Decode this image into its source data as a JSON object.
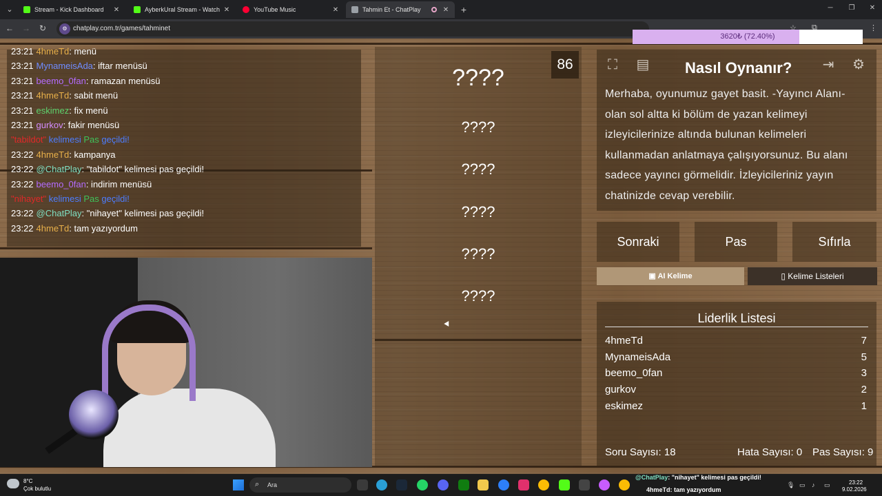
{
  "browser": {
    "tabs": [
      {
        "title": "Stream - Kick Dashboard",
        "icon": "kick-icon",
        "color": "#53fc18"
      },
      {
        "title": "AyberkUral Stream - Watch Live",
        "icon": "kick-icon",
        "color": "#53fc18"
      },
      {
        "title": "YouTube Music",
        "icon": "youtube-music-icon",
        "color": "#ff0033"
      },
      {
        "title": "Tahmin Et - ChatPlay",
        "icon": "chatplay-icon",
        "color": "#9aa0a6"
      }
    ],
    "url": "chatplay.com.tr/games/tahminet"
  },
  "chat": {
    "messages": [
      {
        "time": "23:21",
        "user": "4hmeTd",
        "user_color": "#e8b04a",
        "text": ": menü"
      },
      {
        "time": "23:21",
        "user": "MynameisAda",
        "user_color": "#6f8cff",
        "text": ": iftar menüsü"
      },
      {
        "time": "23:21",
        "user": "beemo_0fan",
        "user_color": "#b46cff",
        "text": ": ramazan menüsü"
      },
      {
        "time": "23:21",
        "user": "4hmeTd",
        "user_color": "#e8b04a",
        "text": ": sabit menü"
      },
      {
        "time": "23:21",
        "user": "eskimez",
        "user_color": "#5ed36e",
        "text": ": fix menü"
      },
      {
        "time": "23:21",
        "user": "gurkov",
        "user_color": "#d48cff",
        "text": ": fakir menüsü"
      },
      {
        "system": true,
        "word": "\"tabildot\"",
        "mid": " kelimesi ",
        "pas": "Pas",
        "end": " geçildi!"
      },
      {
        "time": "23:22",
        "user": "4hmeTd",
        "user_color": "#e8b04a",
        "text": ": kampanya"
      },
      {
        "time": "23:22",
        "user": "@ChatPlay",
        "user_color": "#7fe0c3",
        "text": ": \"tabildot\" kelimesi pas geçildi!"
      },
      {
        "time": "23:22",
        "user": "beemo_0fan",
        "user_color": "#b46cff",
        "text": ": indirim menüsü"
      },
      {
        "system": true,
        "word": "\"nihayet\"",
        "mid": " kelimesi ",
        "pas": "Pas",
        "end": " geçildi!"
      },
      {
        "time": "23:22",
        "user": "@ChatPlay",
        "user_color": "#7fe0c3",
        "text": ": \"nihayet\" kelimesi pas geçildi!"
      },
      {
        "time": "23:22",
        "user": "4hmeTd",
        "user_color": "#e8b04a",
        "text": ": tam yazıyordum"
      }
    ]
  },
  "game": {
    "timer": "86",
    "hidden_words": [
      "????",
      "????",
      "????",
      "????",
      "????",
      "????"
    ]
  },
  "how_to": {
    "title": "Nasıl Oynanır?",
    "text": "Merhaba, oyunumuz gayet basit. -Yayıncı Alanı- olan sol altta ki bölüm de yazan kelimeyi izleyicilerinize altında bulunan kelimeleri kullanmadan anlatmaya çalışıyorsunuz. Bu alanı sadece yayıncı görmelidir. İzleyicileriniz yayın chatinizde cevap verebilir."
  },
  "actions": {
    "next": "Sonraki",
    "pass": "Pas",
    "reset": "Sıfırla",
    "ai_word": "AI Kelime",
    "word_lists": "Kelime Listeleri"
  },
  "leaderboard": {
    "title": "Liderlik Listesi",
    "rows": [
      {
        "name": "4hmeTd",
        "score": "7"
      },
      {
        "name": "MynameisAda",
        "score": "5"
      },
      {
        "name": "beemo_0fan",
        "score": "3"
      },
      {
        "name": "gurkov",
        "score": "2"
      },
      {
        "name": "eskimez",
        "score": "1"
      }
    ],
    "stats": {
      "questions": "Soru Sayısı: 18",
      "errors": "Hata Sayısı: 0",
      "passes": "Pas Sayısı: 9"
    }
  },
  "overlay": {
    "goal_text": "3620₺ (72.40%)",
    "goal_fraction": 0.724
  },
  "taskbar": {
    "weather_temp": "8°C",
    "weather_desc": "Çok bulutlu",
    "search": "Ara",
    "toast_line1_user": "@ChatPlay",
    "toast_line1_text": ": \"nihayet\" kelimesi pas geçildi!",
    "toast_line2_user": "4hmeTd",
    "toast_line2_text": ": tam yazıyordum",
    "time": "23:22",
    "date": "9.02.2026"
  }
}
